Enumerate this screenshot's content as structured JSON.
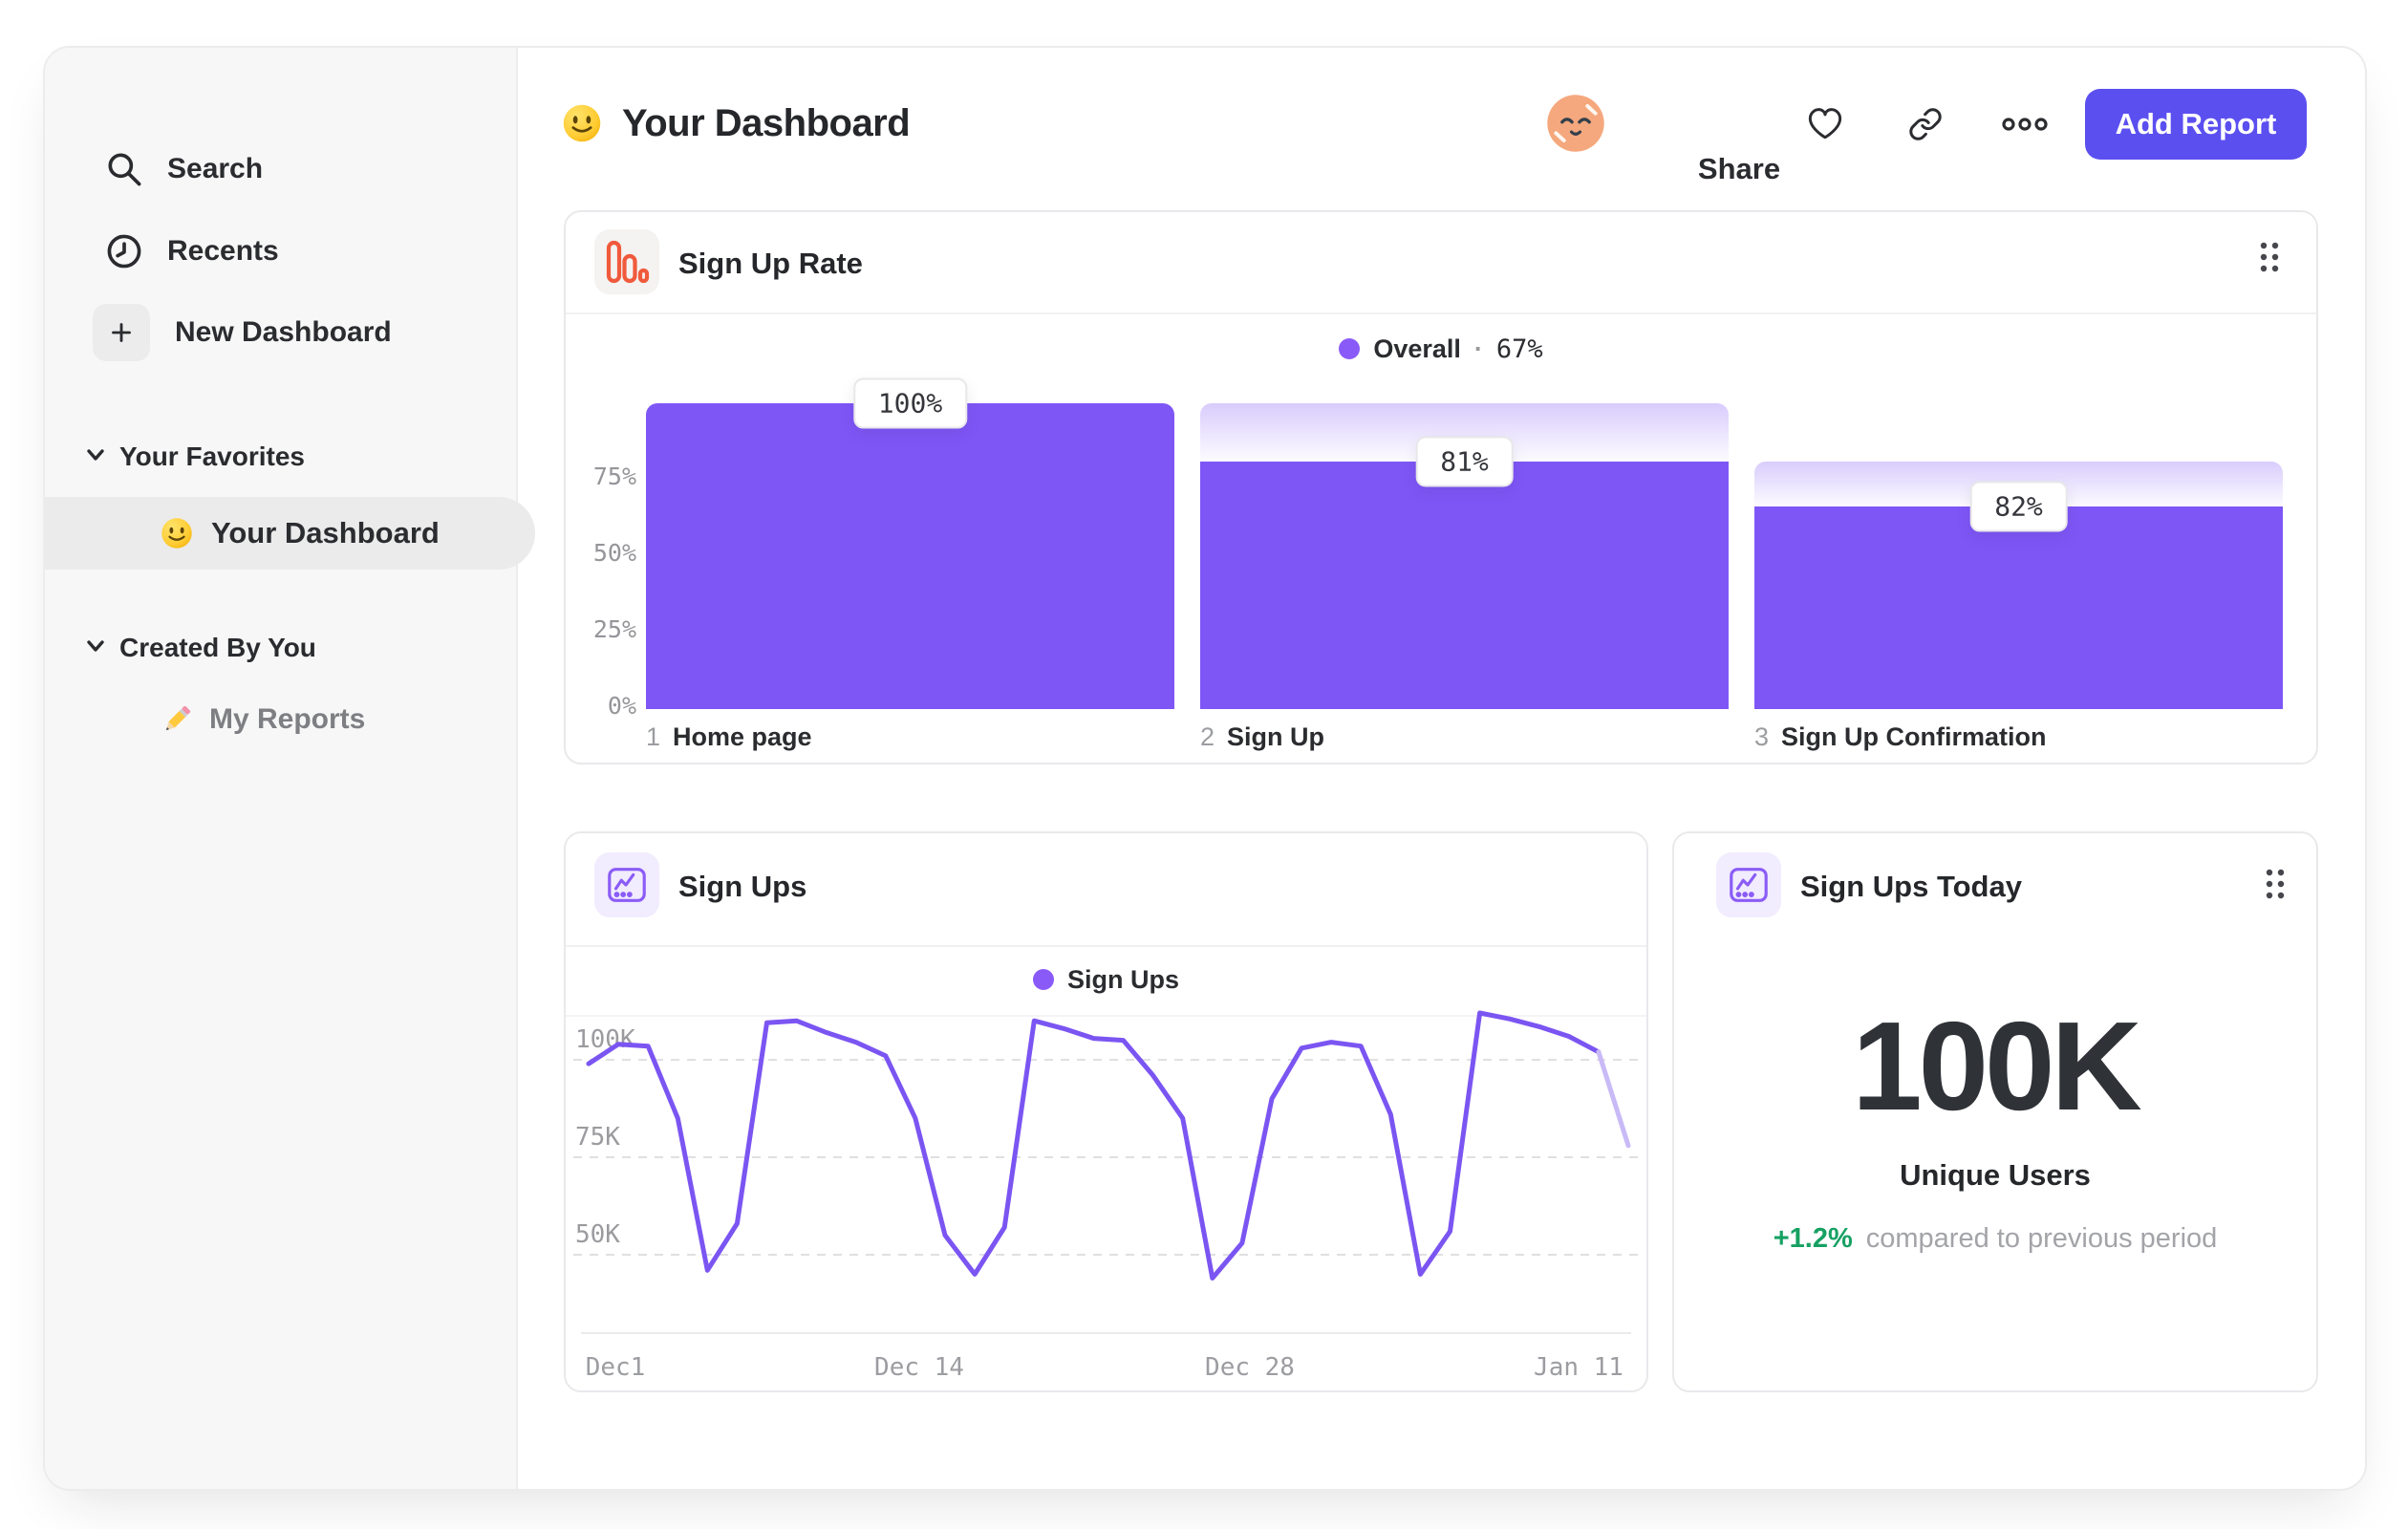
{
  "app": {
    "background": "#ffffff"
  },
  "sidebar": {
    "items": [
      {
        "label": "Search",
        "icon": "search-icon"
      },
      {
        "label": "Recents",
        "icon": "clock-icon"
      },
      {
        "label": "New Dashboard",
        "icon": "plus-icon"
      }
    ],
    "sections": [
      {
        "title": "Your Favorites",
        "items": [
          {
            "label": "Your Dashboard",
            "icon": "smiley-emoji",
            "selected": true
          }
        ]
      },
      {
        "title": "Created By You",
        "items": [
          {
            "label": "My Reports",
            "icon": "pencil-emoji",
            "selected": false
          }
        ]
      }
    ]
  },
  "header": {
    "title": "Your Dashboard",
    "title_emoji": "slightly-smiling-face",
    "share_label": "Share",
    "add_report_label": "Add Report",
    "accent_color": "#5b4ff0",
    "icons": [
      "avatar",
      "heart-icon",
      "link-icon",
      "ellipsis-icon"
    ]
  },
  "cards": {
    "funnel": {
      "title": "Sign Up Rate",
      "icon": "bar-chart-icon",
      "icon_color": "#f05a3c",
      "legend_label": "Overall",
      "legend_separator": "·",
      "legend_value": "67%"
    },
    "line": {
      "title": "Sign Ups",
      "icon": "line-chart-icon",
      "icon_color": "#8b5cf6",
      "legend_label": "Sign Ups"
    },
    "kpi": {
      "title": "Sign Ups Today",
      "icon": "line-chart-icon",
      "value": "100K",
      "subtitle": "Unique Users",
      "delta": "+1.2%",
      "delta_note": "compared to previous period",
      "delta_color": "#16a163"
    }
  },
  "chart_data": [
    {
      "type": "bar",
      "title": "Sign Up Rate",
      "legend": "Overall · 67%",
      "overall_pct": 67,
      "categories": [
        "Home page",
        "Sign Up",
        "Sign Up Confirmation"
      ],
      "step_numbers": [
        "1",
        "2",
        "3"
      ],
      "values": [
        100,
        81,
        82
      ],
      "value_suffix": "%",
      "bar_solid_pct": [
        100,
        81,
        66.4
      ],
      "bar_cap_top_pct": [
        100,
        100,
        81
      ],
      "ytick_values": [
        75,
        50,
        25,
        0
      ],
      "ytick_labels": [
        "75%",
        "50%",
        "25%",
        "0%"
      ],
      "ylim": [
        0,
        100
      ],
      "bar_color": "#7e56f6",
      "legend_dot_color": "#8a5af8",
      "grid": false,
      "legend_position": "top-center"
    },
    {
      "type": "line",
      "title": "Sign Ups",
      "series": [
        {
          "name": "Sign Ups",
          "values_k": [
            99,
            104,
            103.5,
            85,
            46,
            58,
            109.5,
            110,
            107,
            104.5,
            101,
            85,
            55,
            45,
            57,
            110,
            108,
            105.5,
            105,
            96,
            85,
            44,
            53,
            90,
            103,
            104.5,
            103.5,
            86,
            45,
            56,
            112,
            110.5,
            108.5,
            106,
            102,
            78
          ]
        }
      ],
      "x_span": "Dec 1 to Jan 11, daily",
      "x_ticks": [
        "Dec1",
        "Dec 14",
        "Dec 28",
        "Jan 11"
      ],
      "y_ticks": [
        "100K",
        "75K",
        "50K"
      ],
      "ytick_values_k": [
        100,
        75,
        50
      ],
      "ylim_k": [
        38,
        114
      ],
      "grid": "dashed-horizontal",
      "legend_position": "top-center",
      "line_color": "#7b55f2",
      "faded_tail_color": "#c9baf7",
      "faded_tail_segments": 1
    }
  ]
}
